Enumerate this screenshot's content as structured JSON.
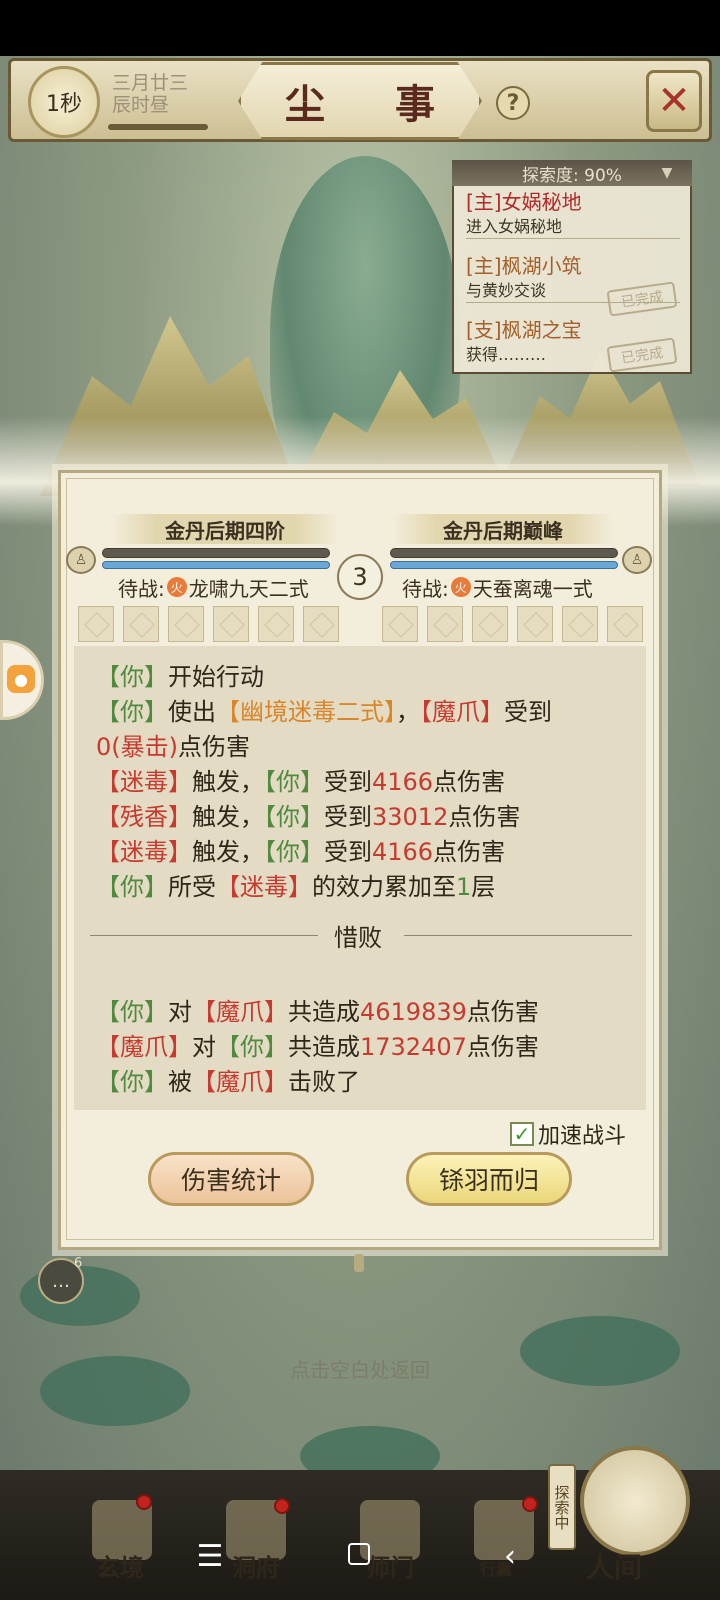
{
  "header": {
    "timer": "1秒",
    "date_line1": "三月廿三",
    "date_line2": "辰时昼",
    "title": "尘 事",
    "help_label": "?",
    "close_label": "✕"
  },
  "quest_panel": {
    "progress_label": "探索度: 90%",
    "items": [
      {
        "title": "[主]女娲秘地",
        "desc": "进入女娲秘地",
        "stamp": ""
      },
      {
        "title": "[主]枫湖小筑",
        "desc": "与黄妙交谈",
        "stamp": "已完成"
      },
      {
        "title": "[支]枫湖之宝",
        "desc": "获得………",
        "stamp": "已完成"
      }
    ]
  },
  "battle": {
    "left": {
      "rank": "金丹后期四阶",
      "wait_prefix": "待战:",
      "skill": "龙啸九天二式",
      "element": "火",
      "hp": 1.0,
      "mp": 1.0
    },
    "right": {
      "rank": "金丹后期巅峰",
      "wait_prefix": "待战:",
      "skill": "天蚕离魂一式",
      "element": "火",
      "hp": 1.0,
      "mp": 1.0
    },
    "round": "3",
    "defeat_label": "惜败",
    "speed_label": "加速战斗",
    "speed_checked": true,
    "btn_stats": "伤害统计",
    "btn_return": "铩羽而归"
  },
  "log": {
    "l1": [
      "【你】",
      "开始行动"
    ],
    "l2": [
      "【你】",
      "使出",
      "【幽境迷毒二式】",
      "，",
      "【魔爪】",
      "受到"
    ],
    "l3": [
      "0(暴击)",
      "点伤害"
    ],
    "l4": [
      "【迷毒】",
      "触发，",
      "【你】",
      "受到",
      "4166",
      "点伤害"
    ],
    "l5": [
      "【残香】",
      "触发，",
      "【你】",
      "受到",
      "33012",
      "点伤害"
    ],
    "l6": [
      "【迷毒】",
      "触发，",
      "【你】",
      "受到",
      "4166",
      "点伤害"
    ],
    "l7": [
      "【你】",
      "所受",
      "【迷毒】",
      "的效力累加至",
      "1",
      "层"
    ],
    "s1": [
      "【你】",
      "对",
      "【魔爪】",
      "共造成",
      "4619839",
      "点伤害"
    ],
    "s2": [
      "【魔爪】",
      "对",
      "【你】",
      "共造成",
      "1732407",
      "点伤害"
    ],
    "s3": [
      "【你】",
      "被",
      "【魔爪】",
      "击败了"
    ]
  },
  "misc": {
    "chat_count": "6",
    "hint": "点击空白处返回",
    "explore_flag": "探索中"
  },
  "nav": {
    "items": [
      "玄境",
      "洞府",
      "师门",
      "行囊",
      "人间"
    ]
  },
  "colors": {
    "you": "#4f8a3e",
    "enemy": "#c63a2f",
    "skill": "#d9862a"
  }
}
